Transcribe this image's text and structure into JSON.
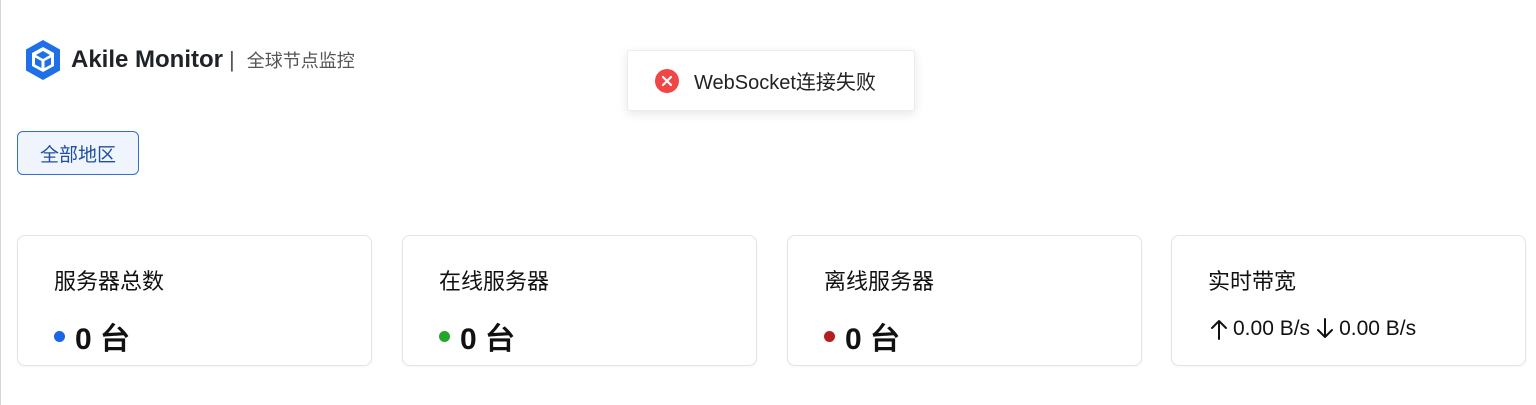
{
  "header": {
    "brand_name": "Akile Monitor",
    "separator": "|",
    "subtitle": "全球节点监控",
    "logo_icon": "cube-logo-icon",
    "brand_color": "#1e6fe8"
  },
  "toast": {
    "message": "WebSocket连接失败",
    "icon": "error-circle-icon",
    "color": "#f04646"
  },
  "filters": {
    "region_button": "全部地区"
  },
  "stats": {
    "total": {
      "title": "服务器总数",
      "value": "0 台",
      "dot_color": "#1a66e6"
    },
    "online": {
      "title": "在线服务器",
      "value": "0 台",
      "dot_color": "#1fa82a"
    },
    "offline": {
      "title": "离线服务器",
      "value": "0 台",
      "dot_color": "#b31f1f"
    },
    "bandwidth": {
      "title": "实时带宽",
      "up": "0.00 B/s",
      "down": "0.00 B/s"
    }
  }
}
